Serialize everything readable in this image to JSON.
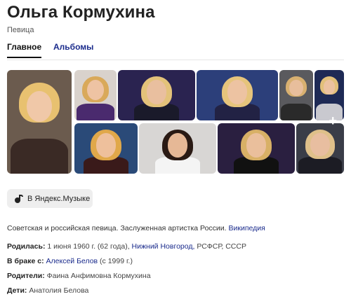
{
  "entity": {
    "name": "Ольга Кормухина",
    "type": "Певица"
  },
  "tabs": [
    {
      "label": "Главное",
      "active": true
    },
    {
      "label": "Альбомы",
      "active": false
    }
  ],
  "gallery": {
    "more_symbol": "+",
    "photos": [
      {
        "bg": "#6b5b4e",
        "hair": "#e8c170",
        "face": "#f0c8a8",
        "body": "#3a2a25"
      },
      {
        "bg": "#d9d2cc",
        "hair": "#d9a95a",
        "face": "#eec3a3",
        "body": "#4a2a6e"
      },
      {
        "bg": "#2a2350",
        "hair": "#e3c27a",
        "face": "#e9bf9f",
        "body": "#1a1a2a"
      },
      {
        "bg": "#2c3f7a",
        "hair": "#e6c47c",
        "face": "#edc3a2",
        "body": "#222244"
      },
      {
        "bg": "#5a5a5e",
        "hair": "#d8b070",
        "face": "#e8be9c",
        "body": "#2a2a2a"
      },
      {
        "bg": "#1e2a55",
        "hair": "#e2c07a",
        "face": "#ecc2a0",
        "body": "#c9c9cf"
      },
      {
        "bg": "#2a4a78",
        "hair": "#e0a84a",
        "face": "#eec09c",
        "body": "#3a1a1a"
      },
      {
        "bg": "#d8d6d4",
        "hair": "#2a1a14",
        "face": "#e6b896",
        "body": "#f4f4f4"
      },
      {
        "bg": "#2a1f40",
        "hair": "#d8b066",
        "face": "#eabf9c",
        "body": "#111"
      },
      {
        "bg": "#3a3d48",
        "hair": "#dfc08a",
        "face": "#e8bea0",
        "body": "#1c1c24"
      }
    ]
  },
  "music_button": {
    "label": "В Яндекс.Музыке",
    "icon": "music-note-icon"
  },
  "description": {
    "text": "Советская и российская певица. Заслуженная артистка России.",
    "source_link": "Википедия"
  },
  "facts": {
    "born": {
      "label": "Родилась:",
      "date": "1 июня 1960 г. (62 года),",
      "place_link": "Нижний Новгород,",
      "rest": "РСФСР, СССР"
    },
    "married": {
      "label": "В браке с:",
      "spouse_link": "Алексей Белов",
      "since": "(с 1999 г.)"
    },
    "parents": {
      "label": "Родители:",
      "value": "Фаина Анфимовна Кормухина"
    },
    "children": {
      "label": "Дети:",
      "value": "Анатолия Белова"
    }
  },
  "colors": {
    "link": "#1a2b8c",
    "button_bg": "#eeeeee"
  }
}
